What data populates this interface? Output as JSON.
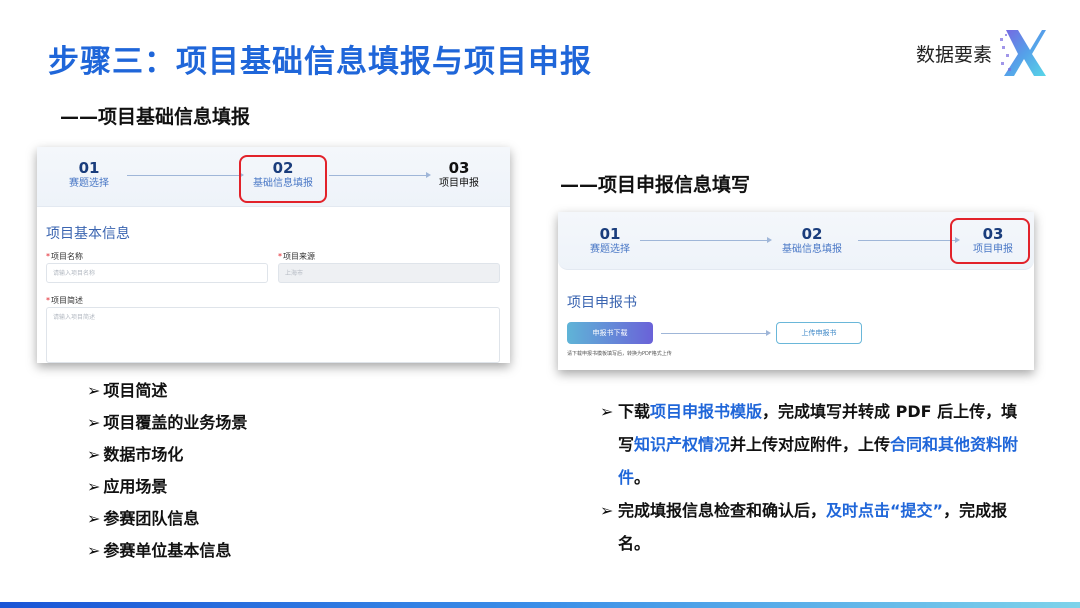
{
  "slide": {
    "title": "步骤三：项目基础信息填报与项目申报",
    "logo_text": "数据要素",
    "section1_heading": "——项目基础信息填报",
    "section2_heading": "——项目申报信息填写"
  },
  "screenshot1": {
    "steps": [
      {
        "num": "01",
        "label": "赛题选择"
      },
      {
        "num": "02",
        "label": "基础信息填报"
      },
      {
        "num": "03",
        "label": "项目申报"
      }
    ],
    "form_title": "项目基本信息",
    "fields": {
      "name_label": "项目名称",
      "name_placeholder": "请输入项目名称",
      "source_label": "项目来源",
      "source_value": "上海市",
      "desc_label": "项目简述",
      "desc_placeholder": "请输入项目简述"
    }
  },
  "screenshot2": {
    "steps": [
      {
        "num": "01",
        "label": "赛题选择"
      },
      {
        "num": "02",
        "label": "基础信息填报"
      },
      {
        "num": "03",
        "label": "项目申报"
      }
    ],
    "form_title": "项目申报书",
    "download_button": "申报书下载",
    "upload_button": "上传申报书",
    "hint": "请下载申报书模板填写后，转换为PDF格式上传"
  },
  "left_bullets": [
    "项目简述",
    "项目覆盖的业务场景",
    "数据市场化",
    "应用场景",
    "参赛团队信息",
    "参赛单位基本信息"
  ],
  "right_bullets": {
    "p1_a": "下载",
    "p1_b": "项目申报书模版",
    "p1_c": "，完成填写并转成 PDF 后上传，填写",
    "p1_d": "知识产权情况",
    "p1_e": "并上传对应附件，上传",
    "p1_f": "合同和其他资料附件",
    "p1_g": "。",
    "p2_a": "完成填报信息检查和确认后，",
    "p2_b": "及时点击“提交”",
    "p2_c": "，完成报名。"
  },
  "colors": {
    "accent": "#1f66d9",
    "highlight_border": "#e2222a"
  },
  "icons": {
    "bullet": "arrowhead-bullet-icon",
    "logo": "x-logo-icon",
    "step_connector": "arrow-right-icon"
  }
}
